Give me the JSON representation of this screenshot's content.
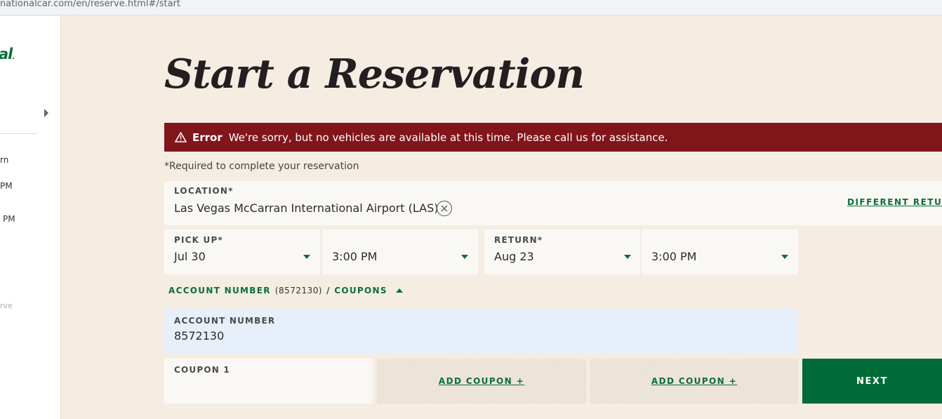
{
  "browser": {
    "url": "nationalcar.com/en/reserve.html#/start"
  },
  "sidebar": {
    "logo_text": "al",
    "logo_mark": ".",
    "items": [
      "rn",
      "PM",
      "PM",
      "rve"
    ]
  },
  "page": {
    "title": "Start a Reservation"
  },
  "error": {
    "label": "Error",
    "message": "We're sorry, but no vehicles are available at this time. Please call us for assistance."
  },
  "required_note": "*Required to complete your reservation",
  "location": {
    "label": "LOCATION*",
    "value": "Las Vegas McCarran International Airport (LAS)",
    "different_return": "DIFFERENT RETURN"
  },
  "pickup": {
    "label": "PICK UP*",
    "date": "Jul 30",
    "time": "3:00 PM"
  },
  "return": {
    "label": "RETURN*",
    "date": "Aug 23",
    "time": "3:00 PM"
  },
  "account": {
    "toggle_label": "ACCOUNT NUMBER",
    "toggle_number": "(8572130)",
    "toggle_suffix": "/ COUPONS",
    "label": "ACCOUNT NUMBER",
    "value": "8572130"
  },
  "coupons": {
    "coupon1_label": "COUPON 1",
    "add_label_1": "ADD COUPON +",
    "add_label_2": "ADD COUPON +"
  },
  "next_label": "NEXT",
  "colors": {
    "brand_green": "#006b37",
    "error_red": "#80151a",
    "background": "#f5ede2"
  }
}
